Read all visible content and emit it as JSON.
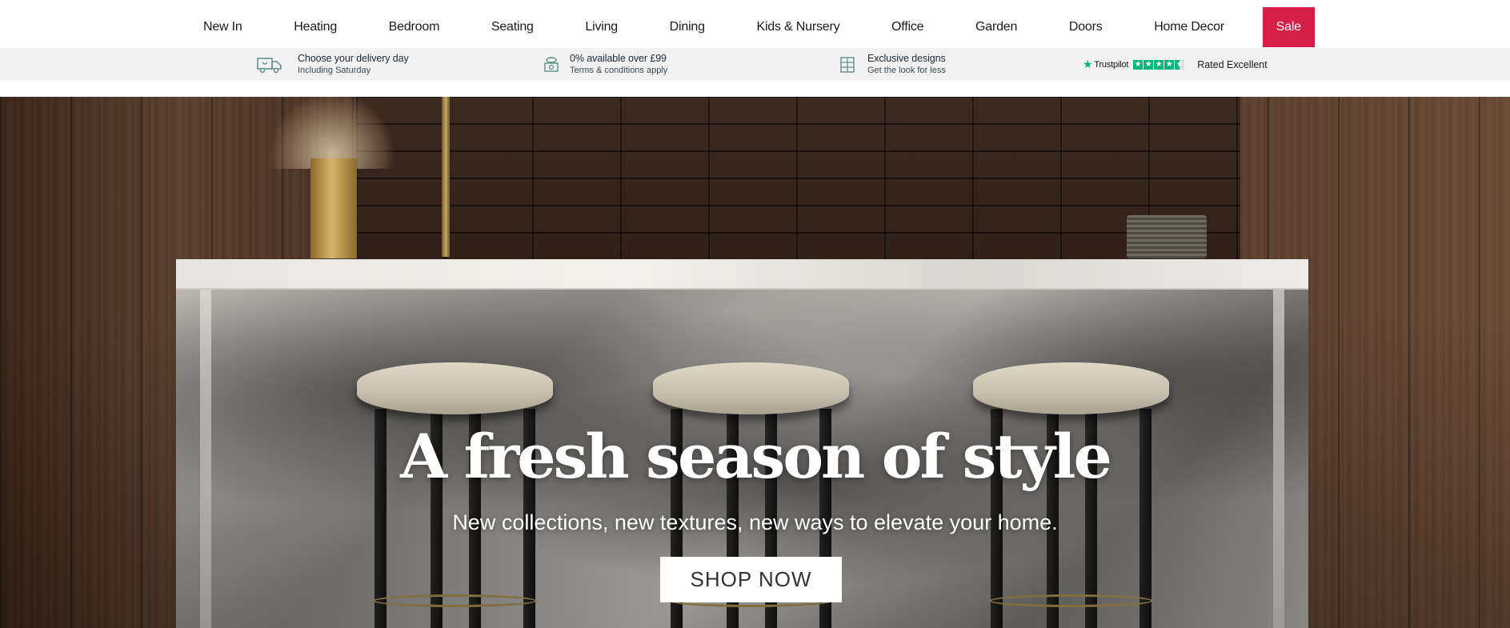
{
  "nav": {
    "items": [
      {
        "label": "New In"
      },
      {
        "label": "Heating"
      },
      {
        "label": "Bedroom"
      },
      {
        "label": "Seating"
      },
      {
        "label": "Living"
      },
      {
        "label": "Dining"
      },
      {
        "label": "Kids & Nursery"
      },
      {
        "label": "Office"
      },
      {
        "label": "Garden"
      },
      {
        "label": "Doors"
      },
      {
        "label": "Home Decor"
      }
    ],
    "sale_label": "Sale",
    "sale_color": "#d61f46"
  },
  "usp": {
    "delivery": {
      "title": "Choose your delivery day",
      "sub": "Including Saturday",
      "icon": "delivery-truck-icon"
    },
    "finance": {
      "title": "0% available over £99",
      "sub": "Terms & conditions apply",
      "icon": "money-stack-icon"
    },
    "designs": {
      "title": "Exclusive designs",
      "sub": "Get the look for less",
      "icon": "designs-grid-icon"
    },
    "trustpilot": {
      "brand": "Trustpilot",
      "rating_label": "Rated Excellent",
      "stars": 4.5,
      "star_color": "#00b67a"
    }
  },
  "hero": {
    "title": "A fresh season of style",
    "subtitle": "New collections, new textures, new ways to elevate your home.",
    "cta_label": "SHOP NOW"
  }
}
